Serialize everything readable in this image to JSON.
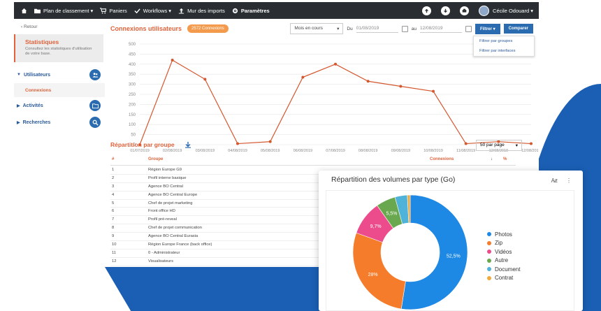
{
  "nav": {
    "home_icon": "home-icon",
    "items": [
      {
        "label": "Plan de classement ▾",
        "icon": "folder-icon"
      },
      {
        "label": "Paniers",
        "icon": "cart-icon"
      },
      {
        "label": "Workflows ▾",
        "icon": "check-icon"
      },
      {
        "label": "Mur des imports",
        "icon": "upload-icon"
      },
      {
        "label": "Paramètres",
        "icon": "gear-icon"
      }
    ],
    "user": "Cécile Odouard ▾"
  },
  "sidebar": {
    "back": "‹ Retour",
    "stat_title": "Statistiques",
    "stat_sub": "Consultez les statistiques d'utilisation de votre base.",
    "items": [
      {
        "label": "Utilisateurs",
        "icon": "users-icon"
      },
      {
        "label": "Activités",
        "icon": "folder-icon"
      },
      {
        "label": "Recherches",
        "icon": "search-icon"
      }
    ],
    "sub": "Connexions"
  },
  "main": {
    "title": "Connexions utilisateurs",
    "badge": "2572 Connexions",
    "period": "Mois en cours",
    "du": "Du",
    "date_from": "01/08/2019",
    "au": "au",
    "date_to": "12/08/2019",
    "filter_btn": "Filtrer ▾",
    "compare_btn": "Comparer",
    "dropdown": [
      "Filtrer par groupes",
      "Filtrer par interfaces"
    ],
    "repartition_title": "Répartition par groupe",
    "per_page": "50 par page",
    "table_headers": {
      "num": "#",
      "group": "Groupe",
      "connexions": "Connexions",
      "sort": "↓",
      "pct": "%"
    },
    "rows": [
      {
        "n": "1",
        "g": "Région Europe G9"
      },
      {
        "n": "2",
        "g": "Profil interne basique"
      },
      {
        "n": "3",
        "g": "Agence BO Central"
      },
      {
        "n": "4",
        "g": "Agence BO Central Europe"
      },
      {
        "n": "5",
        "g": "Chef de projet marketing"
      },
      {
        "n": "6",
        "g": "Front office HD"
      },
      {
        "n": "7",
        "g": "Profil pré-reveal"
      },
      {
        "n": "8",
        "g": "Chef de projet communication"
      },
      {
        "n": "9",
        "g": "Agence BO Central Eurasia"
      },
      {
        "n": "10",
        "g": "Région Europe France (back office)"
      },
      {
        "n": "11",
        "g": "0 - Administrateur"
      },
      {
        "n": "12",
        "g": "Visualisateurs"
      }
    ]
  },
  "chart_data": [
    {
      "type": "line",
      "x": [
        "01/07/2019",
        "02/08/2019",
        "03/08/2019",
        "04/08/2019",
        "05/08/2019",
        "06/08/2019",
        "07/08/2019",
        "08/08/2019",
        "09/08/2019",
        "10/08/2019",
        "11/08/2019",
        "12/08/2019"
      ],
      "y": [
        0,
        420,
        325,
        5,
        15,
        335,
        400,
        315,
        290,
        265,
        5,
        15,
        5
      ],
      "x_full": [
        "01/07/2019",
        "02/08/2019",
        "03/08/2019",
        "04/08/2019",
        "05/08/2019",
        "06/08/2019",
        "07/08/2019",
        "08/08/2019",
        "09/08/2019",
        "10/08/2019",
        "11/08/2019",
        "12/08/2019",
        "12/08/2019"
      ],
      "ylim": [
        0,
        500
      ],
      "yticks": [
        0,
        50,
        100,
        150,
        200,
        250,
        300,
        350,
        400,
        450,
        500
      ],
      "grid": true,
      "color": "#d4572e"
    },
    {
      "type": "pie",
      "title": "Répartition des volumes par type (Go)",
      "labels": [
        "Photos",
        "Zip",
        "Vidéos",
        "Autre",
        "Document",
        "Contrat"
      ],
      "values": [
        52.5,
        28,
        9.7,
        5.5,
        3.5,
        0.8
      ],
      "value_labels": [
        "52,5%",
        "28%",
        "9,7%",
        "5,5%",
        "",
        ""
      ],
      "colors": [
        "#1e88e5",
        "#f57c2b",
        "#ec4c8c",
        "#6aa84f",
        "#4fb3d9",
        "#f2a93b"
      ],
      "legend": "right"
    }
  ]
}
